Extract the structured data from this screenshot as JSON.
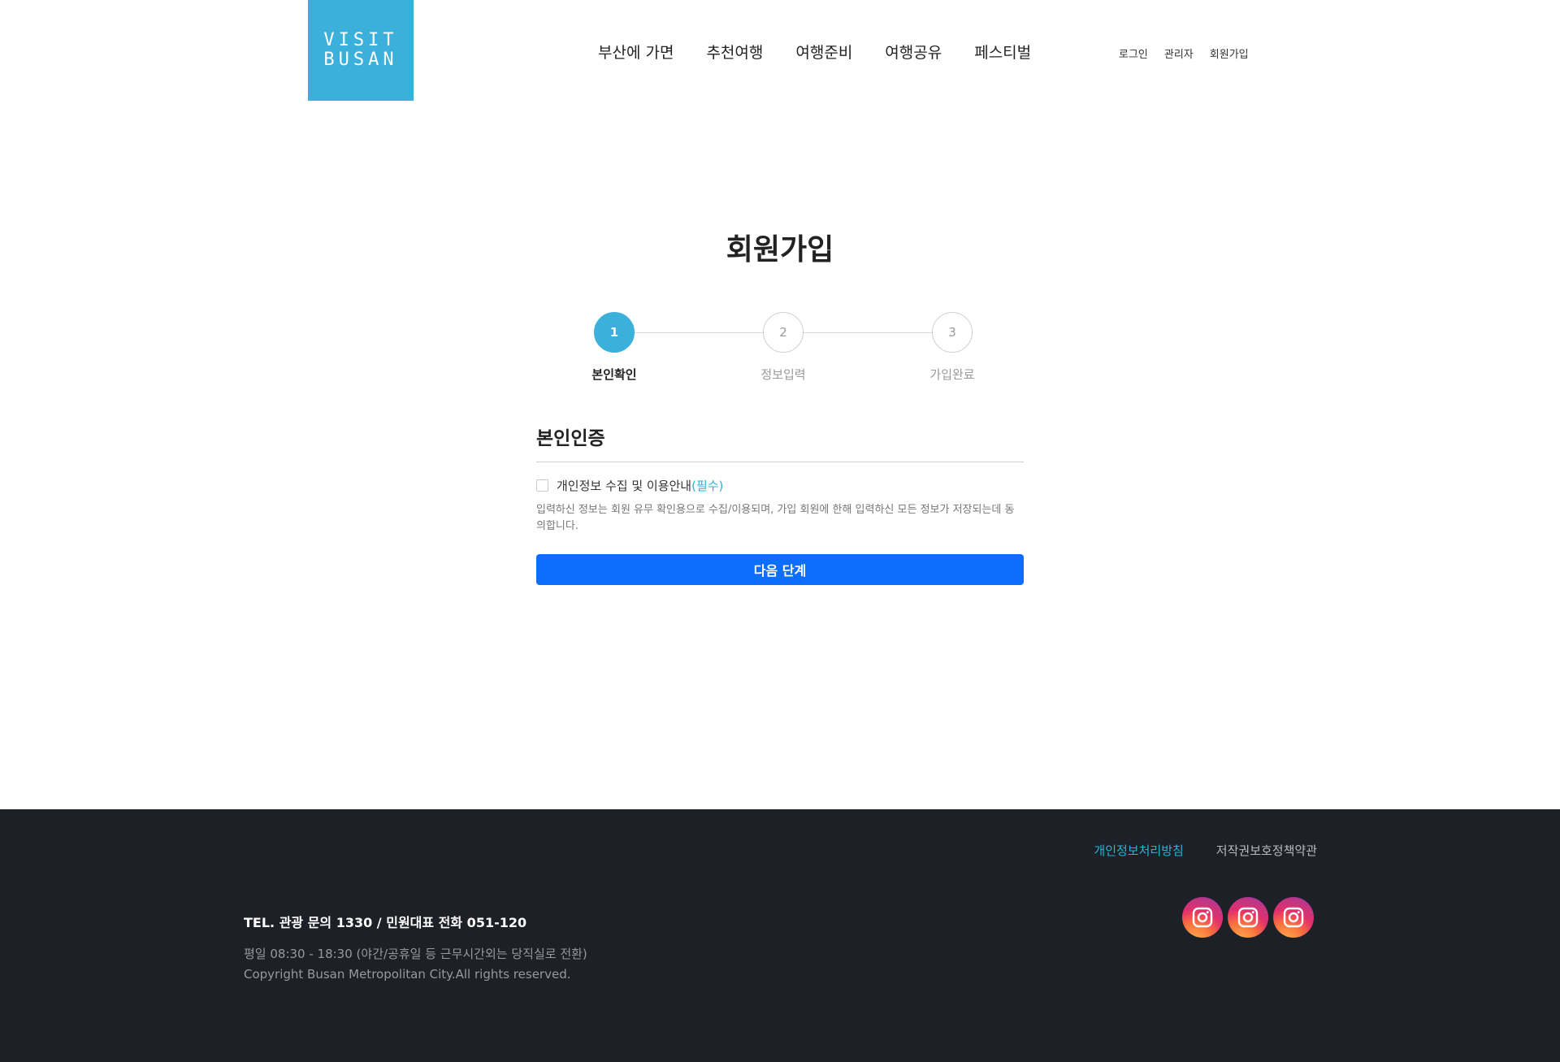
{
  "header": {
    "logo_line1": "VISIT",
    "logo_line2": "BUSAN",
    "nav": [
      "부산에 가면",
      "추천여행",
      "여행준비",
      "여행공유",
      "페스티벌"
    ],
    "util": [
      "로그인",
      "관리자",
      "회원가입"
    ]
  },
  "main": {
    "title": "회원가입",
    "steps": [
      {
        "number": "1",
        "label": "본인확인",
        "active": true
      },
      {
        "number": "2",
        "label": "정보입력",
        "active": false
      },
      {
        "number": "3",
        "label": "가입완료",
        "active": false
      }
    ],
    "section_title": "본인인증",
    "agree_label": "개인정보 수집 및 이용안내",
    "agree_required": "(필수)",
    "agree_checked": false,
    "agree_desc": "입력하신 정보는 회원 유무 확인용으로 수집/이용되며, 가입 회원에 한해 입력하신 모든 정보가 저장되는데 동의합니다.",
    "next_button": "다음 단계"
  },
  "footer": {
    "privacy_policy": "개인정보처리방침",
    "copyright_policy": "저작권보호정책약관",
    "tel": "TEL. 관광 문의 1330 / 민원대표 전화 051-120",
    "hours": "평일 08:30 - 18:30 (야간/공휴일 등 근무시간외는 당직실로 전환)",
    "copyright": "Copyright Busan Metropolitan City.All rights reserved.",
    "sns": [
      "instagram-icon",
      "instagram-icon",
      "instagram-icon"
    ]
  },
  "colors": {
    "brand": "#3ab0da",
    "button": "#0d6efd",
    "footer_bg": "#1e2027",
    "required": "#2ab3d6"
  }
}
